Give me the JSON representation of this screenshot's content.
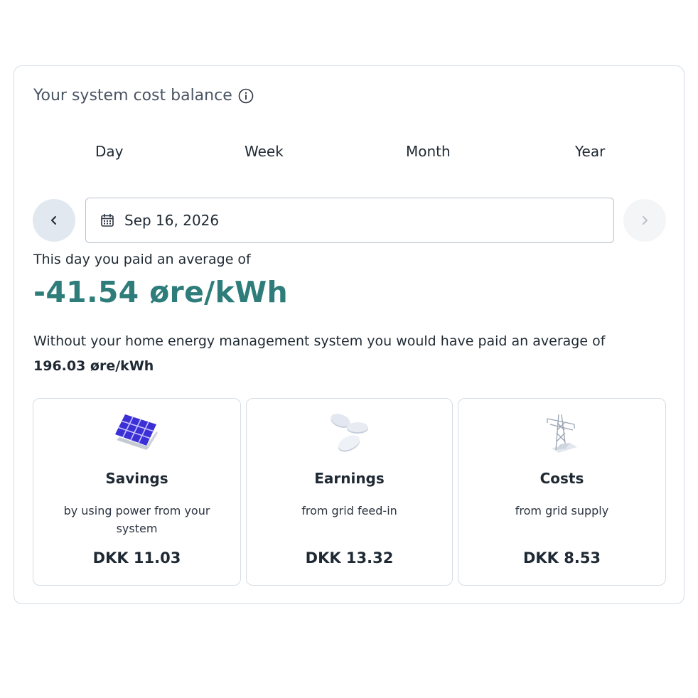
{
  "header": {
    "title": "Your system cost balance",
    "info_icon": "info-circle-icon"
  },
  "tabs": [
    {
      "label": "Day"
    },
    {
      "label": "Week"
    },
    {
      "label": "Month"
    },
    {
      "label": "Year"
    }
  ],
  "date_picker": {
    "value": "Sep 16, 2026",
    "icon": "calendar-icon",
    "prev_icon": "chevron-left-icon",
    "next_icon": "chevron-right-icon"
  },
  "summary": {
    "paid_label": "This day you paid an average of",
    "paid_value": "-41.54 øre/kWh",
    "without_label": "Without your home energy management system you would have paid an average of",
    "without_value": "196.03 øre/kWh"
  },
  "tiles": [
    {
      "icon": "solar-panel-icon",
      "title": "Savings",
      "subtitle": "by using power from your system",
      "amount": "DKK 11.03"
    },
    {
      "icon": "coins-icon",
      "title": "Earnings",
      "subtitle": "from grid feed-in",
      "amount": "DKK 13.32"
    },
    {
      "icon": "power-pylon-icon",
      "title": "Costs",
      "subtitle": "from grid supply",
      "amount": "DKK 8.53"
    }
  ],
  "colors": {
    "accent": "#2e7d7a",
    "border": "#d6dde6",
    "nav_prev_bg": "#e2e8f0",
    "nav_next_bg": "#f3f5f7"
  }
}
